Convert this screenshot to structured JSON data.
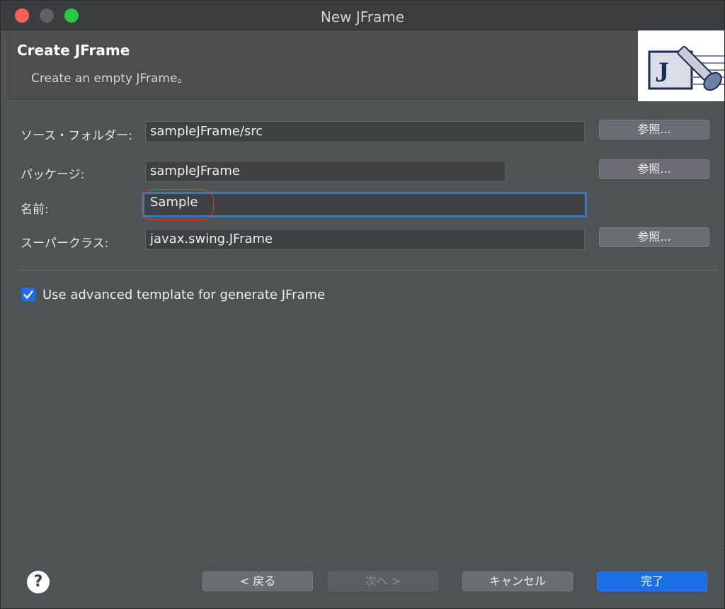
{
  "window": {
    "title": "New JFrame"
  },
  "banner": {
    "title": "Create JFrame",
    "description": "Create an empty JFrame。",
    "image_icon": "jframe-wizard-icon",
    "image_letter": "J"
  },
  "form": {
    "source_folder": {
      "label": "ソース・フォルダー:",
      "value": "sampleJFrame/src",
      "browse": "参照..."
    },
    "package": {
      "label": "パッケージ:",
      "value": "sampleJFrame",
      "browse": "参照..."
    },
    "name": {
      "label": "名前:",
      "value": "Sample"
    },
    "superclass": {
      "label": "スーパークラス:",
      "value": "javax.swing.JFrame",
      "browse": "参照..."
    }
  },
  "options": {
    "advanced_template": {
      "label": "Use advanced template for generate JFrame",
      "checked": true
    }
  },
  "footer": {
    "help": "?",
    "back": "< 戻る",
    "next": "次へ >",
    "cancel": "キャンセル",
    "finish": "完了"
  },
  "colors": {
    "accent": "#1a6ee6",
    "focus_ring": "#3a7bb4",
    "annotation": "#e03a3a",
    "close": "#fe5f57",
    "maximize": "#28c840"
  }
}
